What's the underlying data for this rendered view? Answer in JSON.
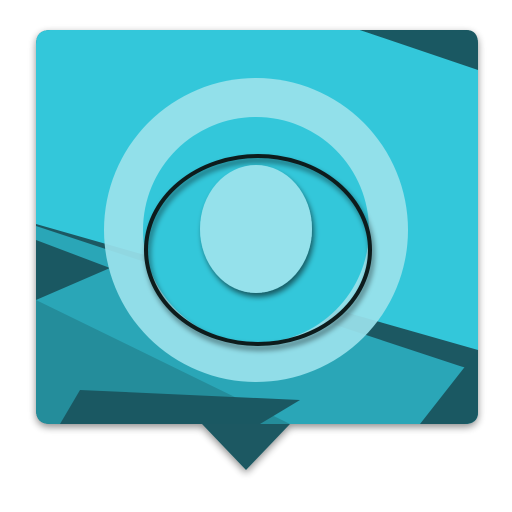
{
  "icon": {
    "name": "chat-bubble-ring-icon",
    "colors": {
      "background": "#ffffff",
      "bubble_dark": "#1a5862",
      "band_mid": "#248d9b",
      "band_light": "#2aa6b7",
      "main_face": "#33c7da",
      "ring_outer": "#9ae2ec",
      "ring_inner": "#33c7da",
      "center": "#95e1eb",
      "outline": "#0b1a1c"
    }
  }
}
